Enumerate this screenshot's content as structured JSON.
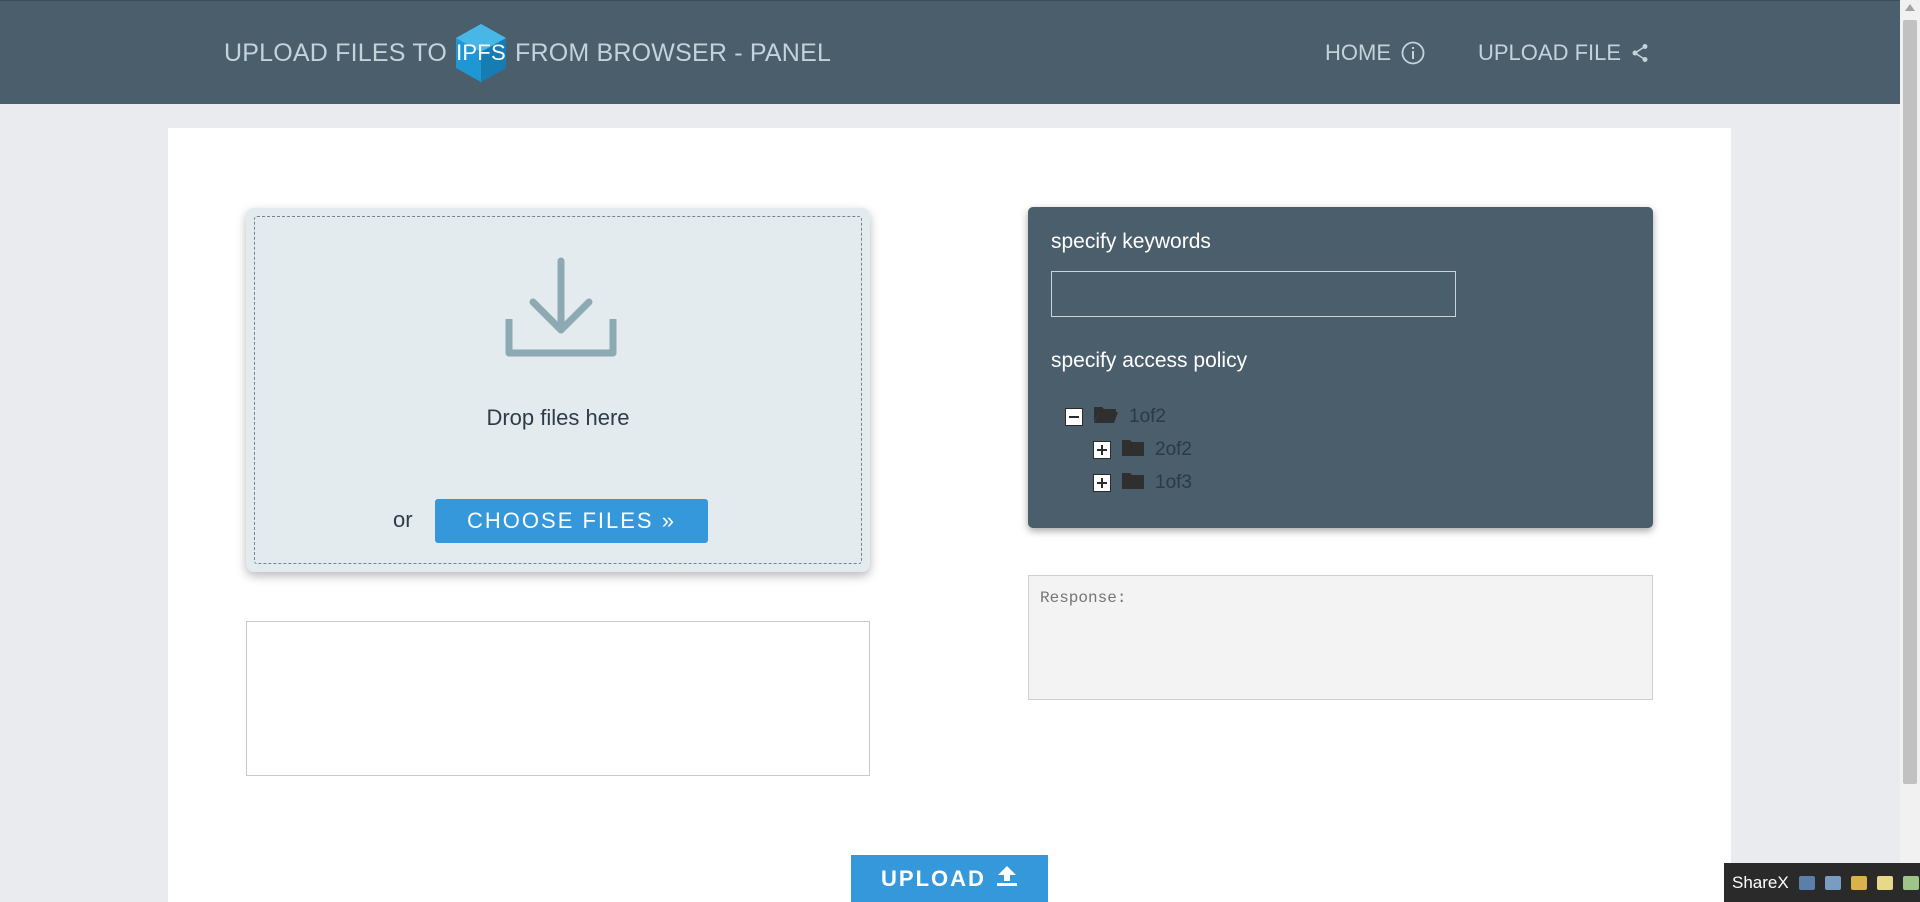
{
  "header": {
    "title_before": "UPLOAD FILES TO",
    "logo_text": "IPFS",
    "title_after": "FROM BROWSER - PANEL",
    "nav": {
      "home_label": "HOME",
      "upload_label": "UPLOAD FILE"
    }
  },
  "dropzone": {
    "drop_text": "Drop files here",
    "or_text": "or",
    "choose_label": "CHOOSE FILES »"
  },
  "policy": {
    "keywords_label": "specify keywords",
    "keywords_value": "",
    "access_label": "specify access policy",
    "tree": [
      {
        "label": "1of2",
        "expanded": true
      },
      {
        "label": "2of2",
        "expanded": false
      },
      {
        "label": "1of3",
        "expanded": false
      }
    ]
  },
  "response": {
    "placeholder": "Response:"
  },
  "upload_label": "UPLOAD",
  "taskbar": {
    "app_label": "ShareX"
  },
  "colors": {
    "header_bg": "#4a5e6c",
    "accent": "#3498db",
    "ipfs": "#1e97d4"
  }
}
